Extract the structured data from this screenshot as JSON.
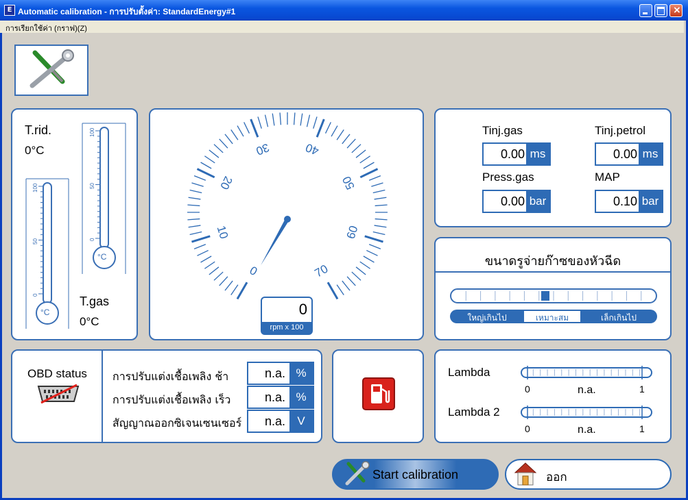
{
  "window": {
    "title": "Automatic calibration - การปรับตั้งค่า: StandardEnergy#1",
    "app_icon_letter": "E"
  },
  "menu": {
    "item": "การเรียกใช้ค่า (กราฟ)(Z)"
  },
  "temperatures": {
    "t_rid_label": "T.rid.",
    "t_rid_value": "0°C",
    "t_gas_label": "T.gas",
    "t_gas_value": "0°C",
    "scale_ticks": [
      "100",
      "50",
      "0"
    ],
    "bulb_unit": "°C"
  },
  "rpm_gauge": {
    "ticks": [
      "0",
      "10",
      "20",
      "30",
      "40",
      "50",
      "60",
      "70"
    ],
    "value": "0",
    "unit": "rpm x 100"
  },
  "injection": {
    "tinj_gas_label": "Tinj.gas",
    "tinj_gas_value": "0.00",
    "tinj_gas_unit": "ms",
    "tinj_petrol_label": "Tinj.petrol",
    "tinj_petrol_value": "0.00",
    "tinj_petrol_unit": "ms",
    "press_gas_label": "Press.gas",
    "press_gas_value": "0.00",
    "press_gas_unit": "bar",
    "map_label": "MAP",
    "map_value": "0.10",
    "map_unit": "bar"
  },
  "nozzle": {
    "title": "ขนาดรูจ่ายก๊าซของหัวฉีด",
    "labels": [
      "ใหญ่เกินไป",
      "เหมาะสม",
      "เล็กเกินไป"
    ],
    "level_fraction": 0.5
  },
  "obd": {
    "label": "OBD status",
    "rows": [
      {
        "label": "การปรับแต่งเชื้อเพลิง ช้า",
        "value": "n.a.",
        "unit": "%"
      },
      {
        "label": "การปรับแต่งเชื้อเพลิง เร็ว",
        "value": "n.a.",
        "unit": "%"
      },
      {
        "label": "สัญญาณออกซิเจนเซนเซอร์",
        "value": "n.a.",
        "unit": "V"
      }
    ]
  },
  "lambda": [
    {
      "label": "Lambda",
      "min": "0",
      "max": "1",
      "value": "n.a."
    },
    {
      "label": "Lambda 2",
      "min": "0",
      "max": "1",
      "value": "n.a."
    }
  ],
  "buttons": {
    "start": "Start calibration",
    "exit": "ออก"
  },
  "colors": {
    "accent": "#2e6bb5",
    "panel_border": "#3a6fb5",
    "fuel_red": "#d9221c"
  }
}
